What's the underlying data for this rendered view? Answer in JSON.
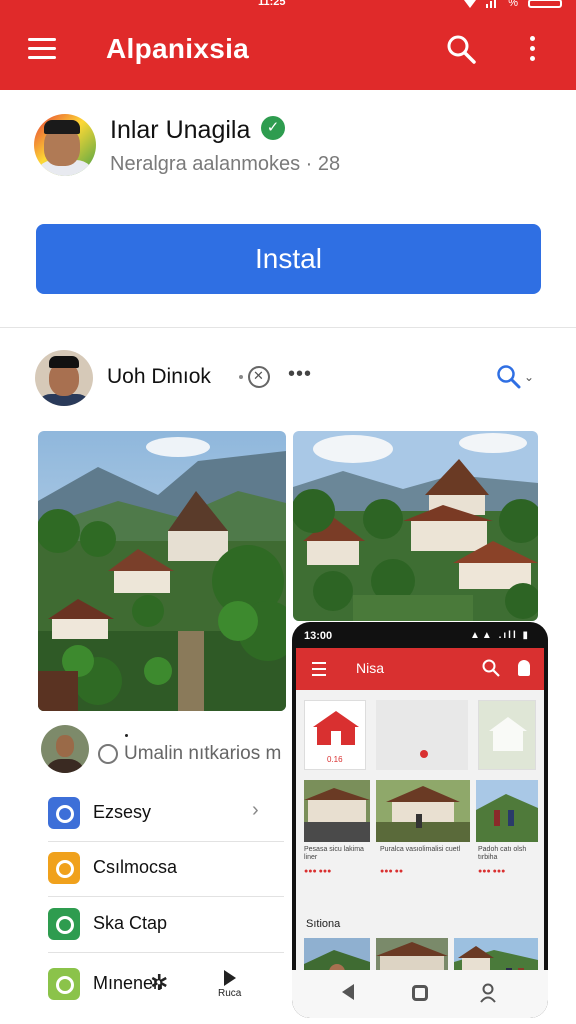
{
  "status_bar": {
    "time": "11:25",
    "battery": "%"
  },
  "app_bar": {
    "title": "Alpanixsia"
  },
  "profile": {
    "name": "Inlar Unagila",
    "verified_mark": "✓",
    "subtitle": "Neralgra aalanmokes · 28"
  },
  "install_button": {
    "label": "Instal"
  },
  "post": {
    "author": "Uoh Dinıok",
    "more": "•••",
    "chevron": "⌄",
    "caption": "Umalin nıtkarios m"
  },
  "list": [
    {
      "label": "Ezsesy",
      "color": "#3d6fd8"
    },
    {
      "label": "Csılmocsa",
      "color": "#f0a11c"
    },
    {
      "label": "Ska Ctap",
      "color": "#2e9c4f"
    },
    {
      "label": "Mınenen",
      "color": "#8bc34a"
    }
  ],
  "list_extras": {
    "chevron": "›",
    "star": "✲",
    "play_label": "Ruca"
  },
  "phone": {
    "time": "13:00",
    "signal": "▲▲ .ıll ▮",
    "title": "Nisa",
    "tile_caption": "0.16",
    "section_title": "Sıtiona",
    "thumb_captions": [
      "Pesasa sicu lakima liner",
      "Puralca vasıolimalisi cuetl",
      "Padoh catı olsh tırbiha"
    ],
    "thumb_prices": [
      "●●● ●●●",
      "●●● ●●",
      "●●● ●●●"
    ]
  },
  "colors": {
    "brand_red": "#e02a2a",
    "install_blue": "#2f6fe3",
    "verified_green": "#2e9c4f"
  },
  "icons": [
    "menu-icon",
    "search-icon",
    "more-vert-icon",
    "verified-icon",
    "search-icon",
    "chevron-right-icon",
    "play-icon",
    "back-icon",
    "home-icon",
    "recent-icon"
  ]
}
